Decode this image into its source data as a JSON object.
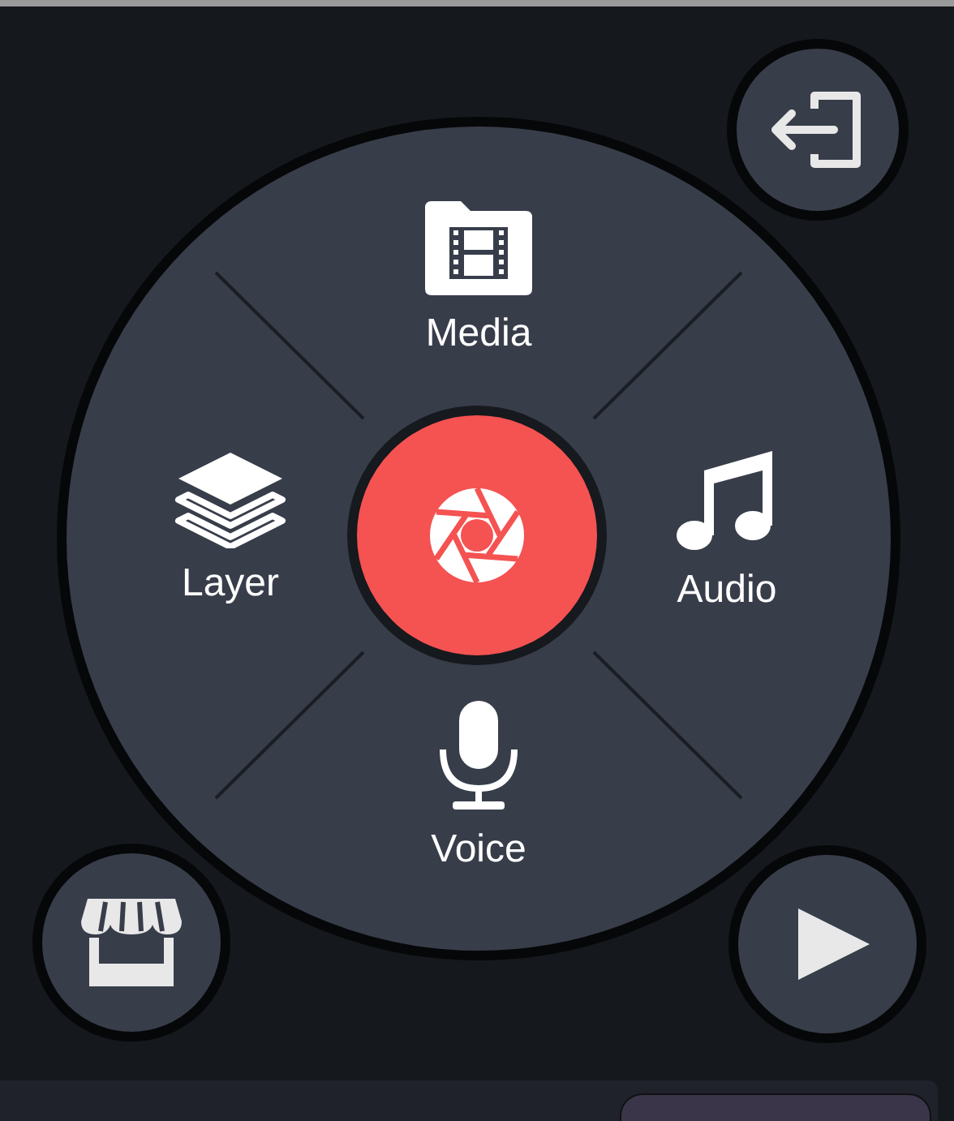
{
  "wheel": {
    "items": [
      {
        "kind": "media",
        "label": "Media"
      },
      {
        "kind": "layer",
        "label": "Layer"
      },
      {
        "kind": "audio",
        "label": "Audio"
      },
      {
        "kind": "voice",
        "label": "Voice"
      }
    ]
  }
}
